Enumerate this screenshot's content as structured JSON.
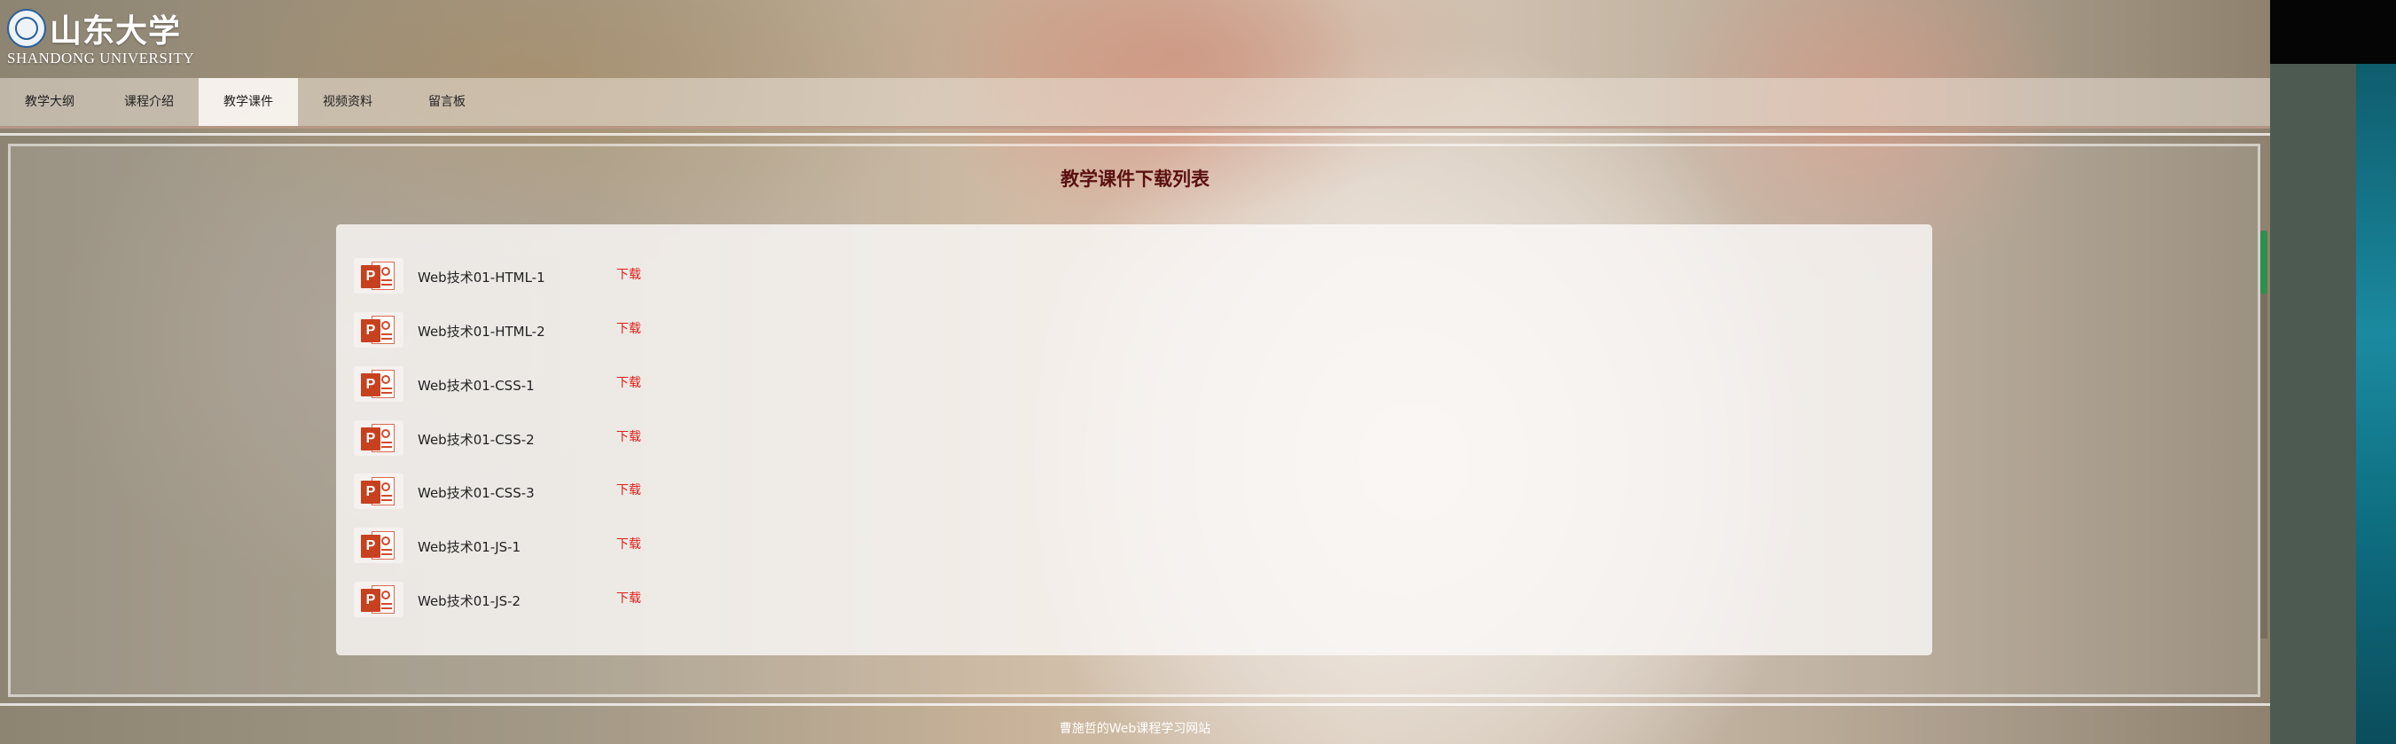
{
  "header": {
    "university_cn": "山东大学",
    "university_en": "SHANDONG UNIVERSITY"
  },
  "nav": {
    "items": [
      {
        "label": "教学大纲"
      },
      {
        "label": "课程介绍"
      },
      {
        "label": "教学课件",
        "active": true
      },
      {
        "label": "视频资料"
      },
      {
        "label": "留言板"
      }
    ]
  },
  "main": {
    "title": "教学课件下载列表",
    "files": [
      {
        "name": "Web技术01-HTML-1",
        "link": "下载"
      },
      {
        "name": "Web技术01-HTML-2",
        "link": "下载"
      },
      {
        "name": "Web技术01-CSS-1",
        "link": "下载"
      },
      {
        "name": "Web技术01-CSS-2",
        "link": "下载"
      },
      {
        "name": "Web技术01-CSS-3",
        "link": "下载"
      },
      {
        "name": "Web技术01-JS-1",
        "link": "下载"
      },
      {
        "name": "Web技术01-JS-2",
        "link": "下载"
      }
    ],
    "file_icon": "powerpoint-icon",
    "file_icon_letter": "P"
  },
  "footer": {
    "text": "曹施哲的Web课程学习网站"
  },
  "colors": {
    "title": "#5a1010",
    "download_link": "#e0201a",
    "ppt_icon": "#c8411f"
  }
}
